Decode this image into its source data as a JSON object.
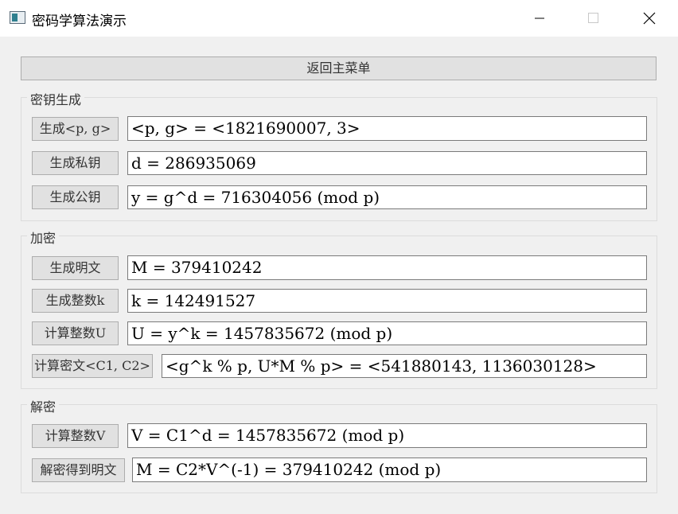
{
  "window": {
    "title": "密码学算法演示"
  },
  "main_menu_button": "返回主菜单",
  "keygen": {
    "title": "密钥生成",
    "gen_pg_button": "生成<p, g>",
    "pg_value": "<p, g> = <1821690007, 3>",
    "gen_private_button": "生成私钥",
    "private_value": "d = 286935069",
    "gen_public_button": "生成公钥",
    "public_value": "y = g^d = 716304056 (mod p)"
  },
  "encrypt": {
    "title": "加密",
    "gen_plaintext_button": "生成明文",
    "plaintext_value": "M = 379410242",
    "gen_k_button": "生成整数k",
    "k_value": "k = 142491527",
    "calc_u_button": "计算整数U",
    "u_value": "U = y^k = 1457835672 (mod p)",
    "calc_cipher_button": "计算密文<C1, C2>",
    "cipher_value": "<g^k % p, U*M % p> = <541880143, 1136030128>"
  },
  "decrypt": {
    "title": "解密",
    "calc_v_button": "计算整数V",
    "v_value": "V = C1^d = 1457835672 (mod p)",
    "get_plaintext_button": "解密得到明文",
    "result_value": "M = C2*V^(-1) = 379410242 (mod p)"
  }
}
